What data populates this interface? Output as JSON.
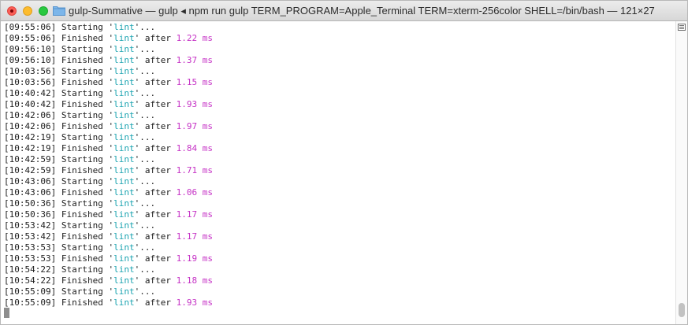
{
  "window": {
    "title": "gulp-Summative — gulp ◂ npm run gulp TERM_PROGRAM=Apple_Terminal TERM=xterm-256color SHELL=/bin/bash — 121×27"
  },
  "terminal": {
    "lines": [
      {
        "ts": "[09:55:06]",
        "word": "Starting",
        "task": "lint",
        "tail": "..."
      },
      {
        "ts": "[09:55:06]",
        "word": "Finished",
        "task": "lint",
        "after": "after",
        "dur": "1.22 ms"
      },
      {
        "ts": "[09:56:10]",
        "word": "Starting",
        "task": "lint",
        "tail": "..."
      },
      {
        "ts": "[09:56:10]",
        "word": "Finished",
        "task": "lint",
        "after": "after",
        "dur": "1.37 ms"
      },
      {
        "ts": "[10:03:56]",
        "word": "Starting",
        "task": "lint",
        "tail": "..."
      },
      {
        "ts": "[10:03:56]",
        "word": "Finished",
        "task": "lint",
        "after": "after",
        "dur": "1.15 ms"
      },
      {
        "ts": "[10:40:42]",
        "word": "Starting",
        "task": "lint",
        "tail": "..."
      },
      {
        "ts": "[10:40:42]",
        "word": "Finished",
        "task": "lint",
        "after": "after",
        "dur": "1.93 ms"
      },
      {
        "ts": "[10:42:06]",
        "word": "Starting",
        "task": "lint",
        "tail": "..."
      },
      {
        "ts": "[10:42:06]",
        "word": "Finished",
        "task": "lint",
        "after": "after",
        "dur": "1.97 ms"
      },
      {
        "ts": "[10:42:19]",
        "word": "Starting",
        "task": "lint",
        "tail": "..."
      },
      {
        "ts": "[10:42:19]",
        "word": "Finished",
        "task": "lint",
        "after": "after",
        "dur": "1.84 ms"
      },
      {
        "ts": "[10:42:59]",
        "word": "Starting",
        "task": "lint",
        "tail": "..."
      },
      {
        "ts": "[10:42:59]",
        "word": "Finished",
        "task": "lint",
        "after": "after",
        "dur": "1.71 ms"
      },
      {
        "ts": "[10:43:06]",
        "word": "Starting",
        "task": "lint",
        "tail": "..."
      },
      {
        "ts": "[10:43:06]",
        "word": "Finished",
        "task": "lint",
        "after": "after",
        "dur": "1.06 ms"
      },
      {
        "ts": "[10:50:36]",
        "word": "Starting",
        "task": "lint",
        "tail": "..."
      },
      {
        "ts": "[10:50:36]",
        "word": "Finished",
        "task": "lint",
        "after": "after",
        "dur": "1.17 ms"
      },
      {
        "ts": "[10:53:42]",
        "word": "Starting",
        "task": "lint",
        "tail": "..."
      },
      {
        "ts": "[10:53:42]",
        "word": "Finished",
        "task": "lint",
        "after": "after",
        "dur": "1.17 ms"
      },
      {
        "ts": "[10:53:53]",
        "word": "Starting",
        "task": "lint",
        "tail": "..."
      },
      {
        "ts": "[10:53:53]",
        "word": "Finished",
        "task": "lint",
        "after": "after",
        "dur": "1.19 ms"
      },
      {
        "ts": "[10:54:22]",
        "word": "Starting",
        "task": "lint",
        "tail": "..."
      },
      {
        "ts": "[10:54:22]",
        "word": "Finished",
        "task": "lint",
        "after": "after",
        "dur": "1.18 ms"
      },
      {
        "ts": "[10:55:09]",
        "word": "Starting",
        "task": "lint",
        "tail": "..."
      },
      {
        "ts": "[10:55:09]",
        "word": "Finished",
        "task": "lint",
        "after": "after",
        "dur": "1.93 ms"
      }
    ]
  },
  "icons": {
    "close": "close-icon",
    "minimize": "minimize-icon",
    "maximize": "maximize-icon",
    "folder": "folder-icon",
    "scroll_menu": "menu-icon"
  },
  "colors": {
    "task": "#1aa3b0",
    "duration": "#c531c5",
    "text": "#1e1e1e",
    "close": "#fc5f57",
    "minimize": "#fdbc2e",
    "maximize": "#28c840"
  }
}
